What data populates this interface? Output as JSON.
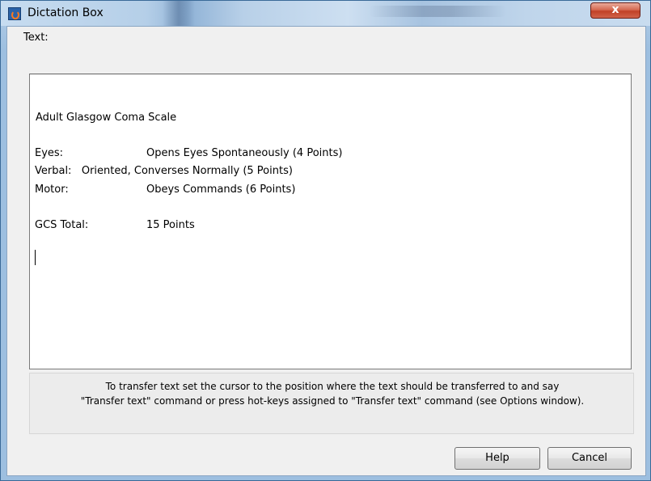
{
  "window": {
    "title": "Dictation Box",
    "close_label": "x"
  },
  "text_label": "Text:",
  "document": {
    "heading": "Adult Glasgow Coma Scale",
    "eyes_label": "Eyes:",
    "eyes_value": "Opens Eyes Spontaneously (4 Points)",
    "verbal_line": "Verbal:   Oriented, Converses Normally (5 Points)",
    "motor_label": "Motor:",
    "motor_value": "Obeys Commands (6 Points)",
    "total_label": "GCS Total:",
    "total_value": "15 Points"
  },
  "info": {
    "line1": "To transfer text set the cursor to the position where the text should be transferred to and say",
    "line2": "\"Transfer text\" command or press hot-keys assigned to \"Transfer text\" command (see Options window)."
  },
  "buttons": {
    "help": "Help",
    "cancel": "Cancel"
  },
  "colors": {
    "close_button": "#c14126",
    "title_bar": "#b5cfe8"
  }
}
